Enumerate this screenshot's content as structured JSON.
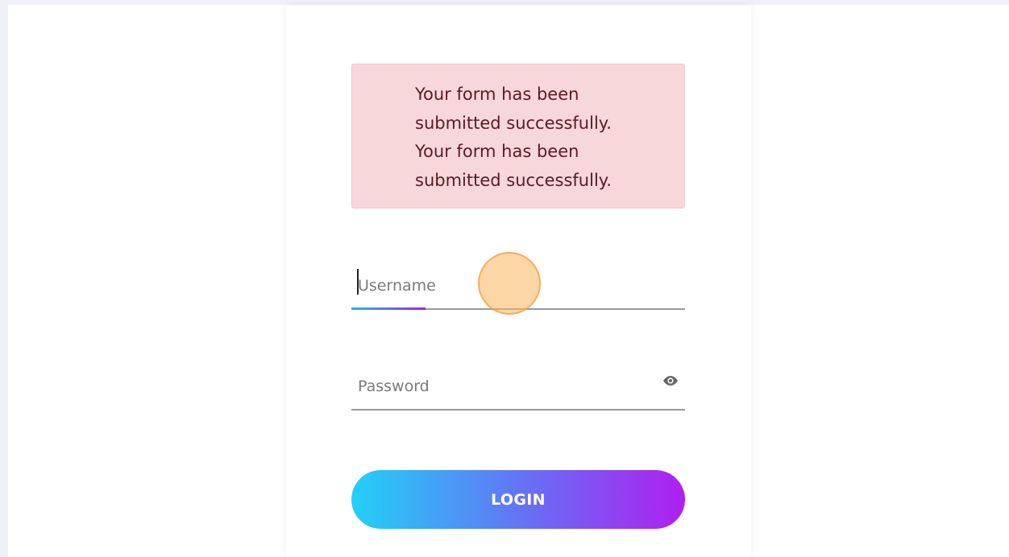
{
  "alert": {
    "lines": [
      "Your form has been",
      "submitted successfully.",
      "Your form has been",
      "submitted successfully."
    ]
  },
  "form": {
    "username": {
      "value": "",
      "placeholder": "Username"
    },
    "password": {
      "value": "",
      "placeholder": "Password",
      "icon": "eye-icon"
    },
    "login_label": "LOGIN"
  },
  "colors": {
    "alert_bg": "#f8d7da",
    "alert_text": "#5a1b22",
    "button_gradient_start": "#22d0f7",
    "button_gradient_end": "#b01ff0",
    "focus_gradient_start": "#22b8f0",
    "focus_gradient_end": "#a024e8"
  }
}
